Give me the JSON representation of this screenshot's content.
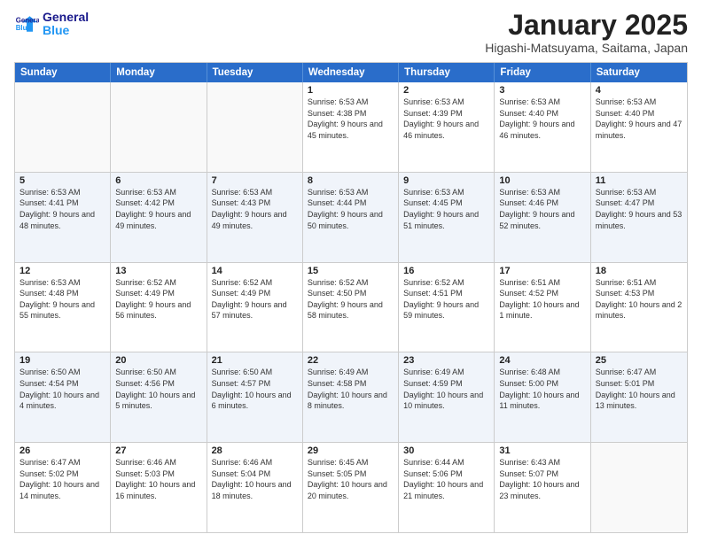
{
  "header": {
    "logo_line1": "General",
    "logo_line2": "Blue",
    "month": "January 2025",
    "location": "Higashi-Matsuyama, Saitama, Japan"
  },
  "weekdays": [
    "Sunday",
    "Monday",
    "Tuesday",
    "Wednesday",
    "Thursday",
    "Friday",
    "Saturday"
  ],
  "rows": [
    {
      "alt": false,
      "cells": [
        {
          "day": "",
          "info": ""
        },
        {
          "day": "",
          "info": ""
        },
        {
          "day": "",
          "info": ""
        },
        {
          "day": "1",
          "info": "Sunrise: 6:53 AM\nSunset: 4:38 PM\nDaylight: 9 hours and 45 minutes."
        },
        {
          "day": "2",
          "info": "Sunrise: 6:53 AM\nSunset: 4:39 PM\nDaylight: 9 hours and 46 minutes."
        },
        {
          "day": "3",
          "info": "Sunrise: 6:53 AM\nSunset: 4:40 PM\nDaylight: 9 hours and 46 minutes."
        },
        {
          "day": "4",
          "info": "Sunrise: 6:53 AM\nSunset: 4:40 PM\nDaylight: 9 hours and 47 minutes."
        }
      ]
    },
    {
      "alt": true,
      "cells": [
        {
          "day": "5",
          "info": "Sunrise: 6:53 AM\nSunset: 4:41 PM\nDaylight: 9 hours and 48 minutes."
        },
        {
          "day": "6",
          "info": "Sunrise: 6:53 AM\nSunset: 4:42 PM\nDaylight: 9 hours and 49 minutes."
        },
        {
          "day": "7",
          "info": "Sunrise: 6:53 AM\nSunset: 4:43 PM\nDaylight: 9 hours and 49 minutes."
        },
        {
          "day": "8",
          "info": "Sunrise: 6:53 AM\nSunset: 4:44 PM\nDaylight: 9 hours and 50 minutes."
        },
        {
          "day": "9",
          "info": "Sunrise: 6:53 AM\nSunset: 4:45 PM\nDaylight: 9 hours and 51 minutes."
        },
        {
          "day": "10",
          "info": "Sunrise: 6:53 AM\nSunset: 4:46 PM\nDaylight: 9 hours and 52 minutes."
        },
        {
          "day": "11",
          "info": "Sunrise: 6:53 AM\nSunset: 4:47 PM\nDaylight: 9 hours and 53 minutes."
        }
      ]
    },
    {
      "alt": false,
      "cells": [
        {
          "day": "12",
          "info": "Sunrise: 6:53 AM\nSunset: 4:48 PM\nDaylight: 9 hours and 55 minutes."
        },
        {
          "day": "13",
          "info": "Sunrise: 6:52 AM\nSunset: 4:49 PM\nDaylight: 9 hours and 56 minutes."
        },
        {
          "day": "14",
          "info": "Sunrise: 6:52 AM\nSunset: 4:49 PM\nDaylight: 9 hours and 57 minutes."
        },
        {
          "day": "15",
          "info": "Sunrise: 6:52 AM\nSunset: 4:50 PM\nDaylight: 9 hours and 58 minutes."
        },
        {
          "day": "16",
          "info": "Sunrise: 6:52 AM\nSunset: 4:51 PM\nDaylight: 9 hours and 59 minutes."
        },
        {
          "day": "17",
          "info": "Sunrise: 6:51 AM\nSunset: 4:52 PM\nDaylight: 10 hours and 1 minute."
        },
        {
          "day": "18",
          "info": "Sunrise: 6:51 AM\nSunset: 4:53 PM\nDaylight: 10 hours and 2 minutes."
        }
      ]
    },
    {
      "alt": true,
      "cells": [
        {
          "day": "19",
          "info": "Sunrise: 6:50 AM\nSunset: 4:54 PM\nDaylight: 10 hours and 4 minutes."
        },
        {
          "day": "20",
          "info": "Sunrise: 6:50 AM\nSunset: 4:56 PM\nDaylight: 10 hours and 5 minutes."
        },
        {
          "day": "21",
          "info": "Sunrise: 6:50 AM\nSunset: 4:57 PM\nDaylight: 10 hours and 6 minutes."
        },
        {
          "day": "22",
          "info": "Sunrise: 6:49 AM\nSunset: 4:58 PM\nDaylight: 10 hours and 8 minutes."
        },
        {
          "day": "23",
          "info": "Sunrise: 6:49 AM\nSunset: 4:59 PM\nDaylight: 10 hours and 10 minutes."
        },
        {
          "day": "24",
          "info": "Sunrise: 6:48 AM\nSunset: 5:00 PM\nDaylight: 10 hours and 11 minutes."
        },
        {
          "day": "25",
          "info": "Sunrise: 6:47 AM\nSunset: 5:01 PM\nDaylight: 10 hours and 13 minutes."
        }
      ]
    },
    {
      "alt": false,
      "cells": [
        {
          "day": "26",
          "info": "Sunrise: 6:47 AM\nSunset: 5:02 PM\nDaylight: 10 hours and 14 minutes."
        },
        {
          "day": "27",
          "info": "Sunrise: 6:46 AM\nSunset: 5:03 PM\nDaylight: 10 hours and 16 minutes."
        },
        {
          "day": "28",
          "info": "Sunrise: 6:46 AM\nSunset: 5:04 PM\nDaylight: 10 hours and 18 minutes."
        },
        {
          "day": "29",
          "info": "Sunrise: 6:45 AM\nSunset: 5:05 PM\nDaylight: 10 hours and 20 minutes."
        },
        {
          "day": "30",
          "info": "Sunrise: 6:44 AM\nSunset: 5:06 PM\nDaylight: 10 hours and 21 minutes."
        },
        {
          "day": "31",
          "info": "Sunrise: 6:43 AM\nSunset: 5:07 PM\nDaylight: 10 hours and 23 minutes."
        },
        {
          "day": "",
          "info": ""
        }
      ]
    }
  ]
}
